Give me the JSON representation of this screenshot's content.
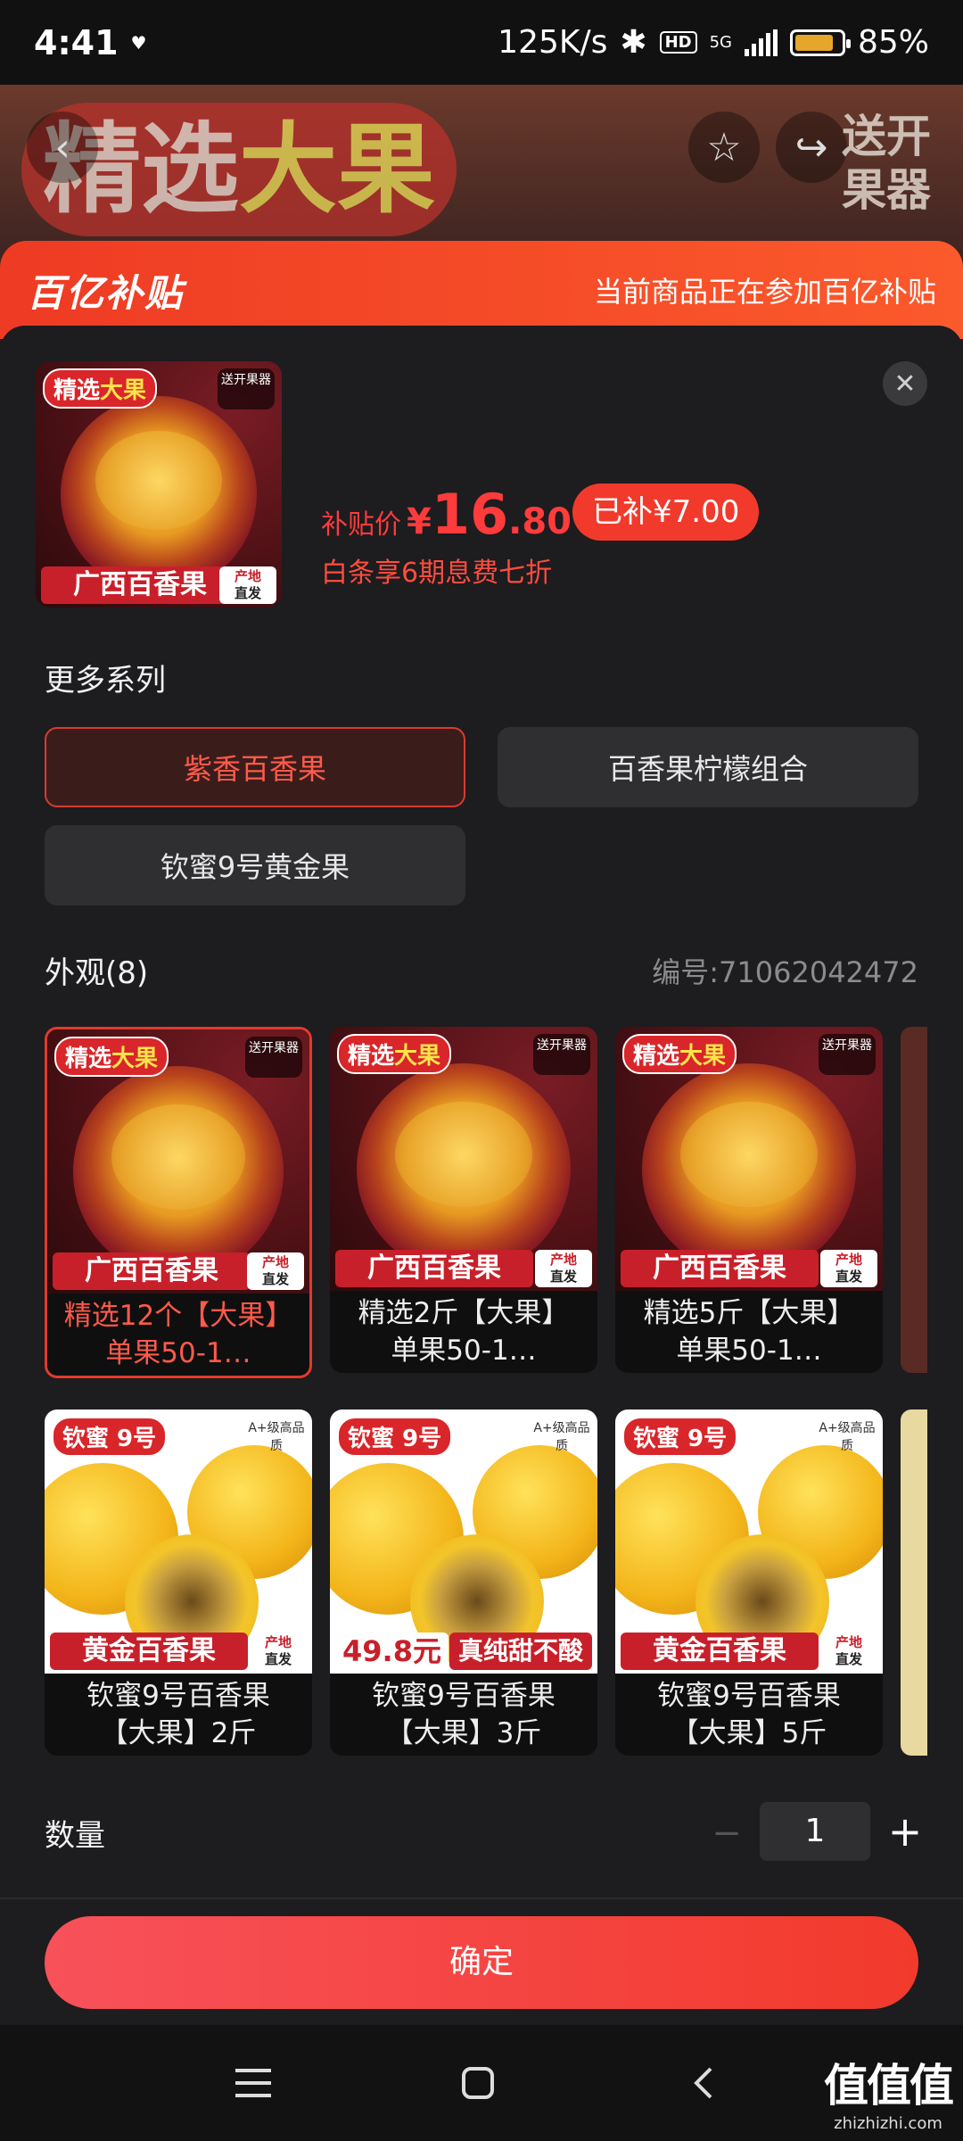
{
  "status_bar": {
    "time": "4:41",
    "speed": "125K/s",
    "battery": "85%",
    "network": "5G",
    "hd": "HD"
  },
  "hero": {
    "title_part1": "精选",
    "title_part2": "大果",
    "tag_line1": "送开",
    "tag_line2": "果器"
  },
  "banner": {
    "logo": "百亿补贴",
    "text": "当前商品正在参加百亿补贴"
  },
  "product": {
    "price_label": "补贴价",
    "price_yen": "¥",
    "price_int": "16",
    "price_dec": ".80",
    "subsidy_badge": "已补¥7.00",
    "installment": "白条享6期息费七折"
  },
  "series": {
    "title": "更多系列",
    "items": [
      "紫香百香果",
      "百香果柠檬组合",
      "钦蜜9号黄金果"
    ],
    "active_index": 0
  },
  "appearance": {
    "title": "外观(8)",
    "code": "编号:71062042472",
    "row1": [
      {
        "caption": "精选12个【大果】单果50-1…",
        "tag_top_a": "精选",
        "tag_top_b": "大果",
        "tag_corner": "送开果器",
        "tag_bottom": "广西百香果",
        "tag_origin_a": "产地",
        "tag_origin_b": "直发"
      },
      {
        "caption": "精选2斤【大果】单果50-1…",
        "tag_top_a": "精选",
        "tag_top_b": "大果",
        "tag_corner": "送开果器",
        "tag_bottom": "广西百香果",
        "tag_origin_a": "产地",
        "tag_origin_b": "直发"
      },
      {
        "caption": "精选5斤【大果】单果50-1…",
        "tag_top_a": "精选",
        "tag_top_b": "大果",
        "tag_corner": "送开果器",
        "tag_bottom": "广西百香果",
        "tag_origin_a": "产地",
        "tag_origin_b": "直发"
      }
    ],
    "row2": [
      {
        "caption": "钦蜜9号百香果【大果】2斤",
        "tag_top": "钦蜜 9号",
        "tag_corner": "A+级高品质",
        "tag_bottom": "黄金百香果",
        "tag_origin_a": "产地",
        "tag_origin_b": "直发"
      },
      {
        "caption": "钦蜜9号百香果【大果】3斤",
        "tag_top": "钦蜜 9号",
        "tag_corner": "A+级高品质",
        "tag_price": "49.8元",
        "tag_slogan": "真纯甜不酸"
      },
      {
        "caption": "钦蜜9号百香果【大果】5斤",
        "tag_top": "钦蜜 9号",
        "tag_corner": "A+级高品质",
        "tag_bottom": "黄金百香果",
        "tag_origin_a": "产地",
        "tag_origin_b": "直发"
      }
    ],
    "active_index": 0
  },
  "quantity": {
    "label": "数量",
    "value": "1",
    "minus": "−",
    "plus": "+"
  },
  "confirm_label": "确定",
  "watermark": {
    "big": "值值值",
    "small": "zhizhizhi.com"
  },
  "colors": {
    "accent": "#f23a2c",
    "background": "#1d1c1f",
    "chip": "#2f2f32"
  }
}
